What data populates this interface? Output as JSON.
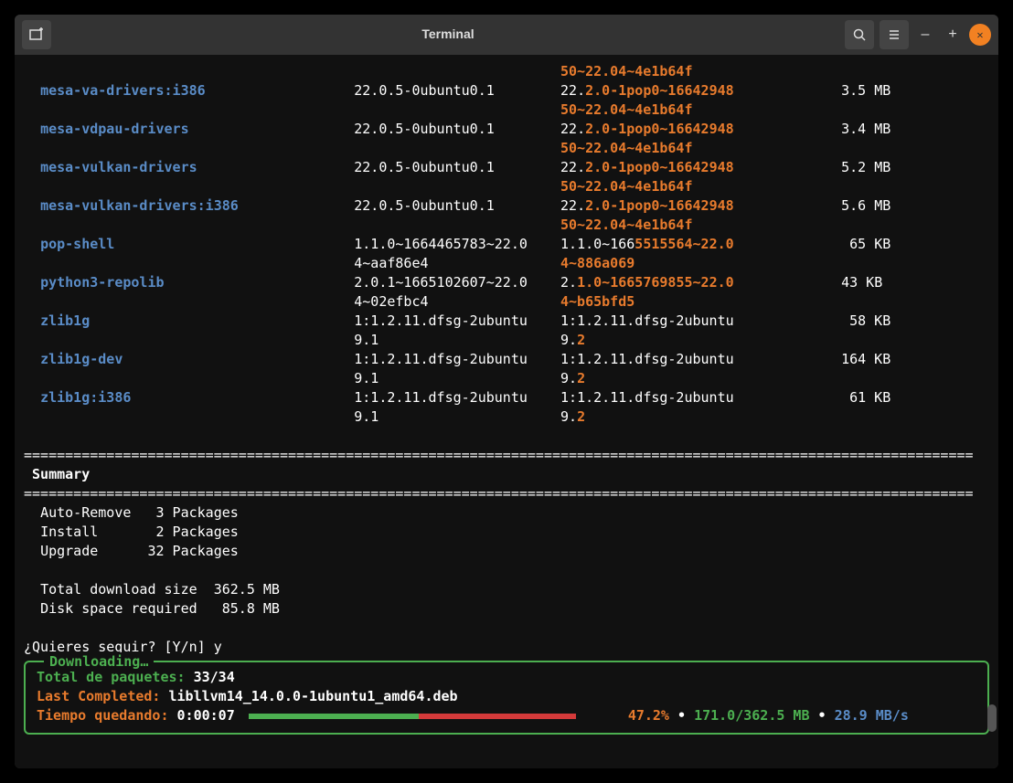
{
  "window": {
    "title": "Terminal"
  },
  "packages": [
    {
      "name": "",
      "old": "",
      "new_pre": "",
      "new_diff": "50~22.04~4e1b64f",
      "size": ""
    },
    {
      "name": "mesa-va-drivers:i386",
      "old": "22.0.5-0ubuntu0.1",
      "new_pre": "22.",
      "new_diff": "2.0-1pop0~1664294850~22.04~4e1b64f",
      "size": "3.5 MB"
    },
    {
      "name": "mesa-vdpau-drivers",
      "old": "22.0.5-0ubuntu0.1",
      "new_pre": "22.",
      "new_diff": "2.0-1pop0~1664294850~22.04~4e1b64f",
      "size": "3.4 MB"
    },
    {
      "name": "mesa-vulkan-drivers",
      "old": "22.0.5-0ubuntu0.1",
      "new_pre": "22.",
      "new_diff": "2.0-1pop0~1664294850~22.04~4e1b64f",
      "size": "5.2 MB"
    },
    {
      "name": "mesa-vulkan-drivers:i386",
      "old": "22.0.5-0ubuntu0.1",
      "new_pre": "22.",
      "new_diff": "2.0-1pop0~1664294850~22.04~4e1b64f",
      "size": "5.6 MB"
    },
    {
      "name": "pop-shell",
      "old": "1.1.0~1664465783~22.04~aaf86e4",
      "new_pre": "1.1.0~166",
      "new_diff": "5515564~22.04~886a069",
      "size": "65 KB"
    },
    {
      "name": "python3-repolib",
      "old": "2.0.1~1665102607~22.04~02efbc4",
      "new_pre": "2.",
      "new_diff": "1.0~1665769855~22.04~b65bfd5",
      "size": "43 KB"
    },
    {
      "name": "zlib1g",
      "old": "1:1.2.11.dfsg-2ubuntu9.1",
      "new_pre": "1:1.2.11.dfsg-2ubuntu9.",
      "new_diff": "2",
      "size": "58 KB"
    },
    {
      "name": "zlib1g-dev",
      "old": "1:1.2.11.dfsg-2ubuntu9.1",
      "new_pre": "1:1.2.11.dfsg-2ubuntu9.",
      "new_diff": "2",
      "size": "164 KB"
    },
    {
      "name": "zlib1g:i386",
      "old": "1:1.2.11.dfsg-2ubuntu9.1",
      "new_pre": "1:1.2.11.dfsg-2ubuntu9.",
      "new_diff": "2",
      "size": "61 KB"
    }
  ],
  "summary": {
    "title": "Summary",
    "auto_remove_label": "Auto-Remove",
    "auto_remove_count": "3 Packages",
    "install_label": "Install",
    "install_count": "2 Packages",
    "upgrade_label": "Upgrade",
    "upgrade_count": "32 Packages",
    "download_size_label": "Total download size",
    "download_size": "362.5 MB",
    "disk_space_label": "Disk space required",
    "disk_space": "85.8 MB"
  },
  "prompt": "¿Quieres seguir? [Y/n] y",
  "downloading": {
    "title": "Downloading…",
    "total_label": "Total de paquetes:",
    "total_value": "33/34",
    "last_label": "Last Completed:",
    "last_value": "libllvm14_14.0.0-1ubuntu1_amd64.deb",
    "time_label": "Tiempo quedando:",
    "time_value": "0:00:07",
    "percent": "47.2%",
    "bytes": "171.0/362.5 MB",
    "rate": "28.9 MB/s",
    "bar_green_width": 186,
    "bar_red_width": 172,
    "bar_blank_width": 42
  },
  "divider": "==================================================================================================================="
}
